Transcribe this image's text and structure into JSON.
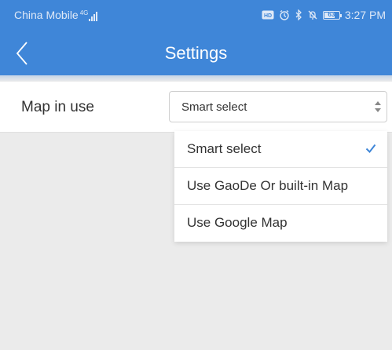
{
  "status_bar": {
    "carrier": "China Mobile",
    "network_type": "4G",
    "time": "3:27 PM",
    "battery": "63",
    "icons": [
      "signal-icon",
      "hd-icon",
      "alarm-icon",
      "bluetooth-icon",
      "mute-icon",
      "battery-icon"
    ]
  },
  "nav": {
    "title": "Settings",
    "back_icon": "chevron-left-icon"
  },
  "settings": {
    "map_label": "Map in use",
    "map_select": {
      "selected": "Smart select",
      "options": [
        {
          "label": "Smart select",
          "checked": true
        },
        {
          "label": "Use GaoDe Or built-in Map",
          "checked": false
        },
        {
          "label": "Use Google Map",
          "checked": false
        }
      ]
    }
  },
  "colors": {
    "header": "#3f86d8",
    "background": "#ebebeb",
    "check": "#3f86d8"
  }
}
